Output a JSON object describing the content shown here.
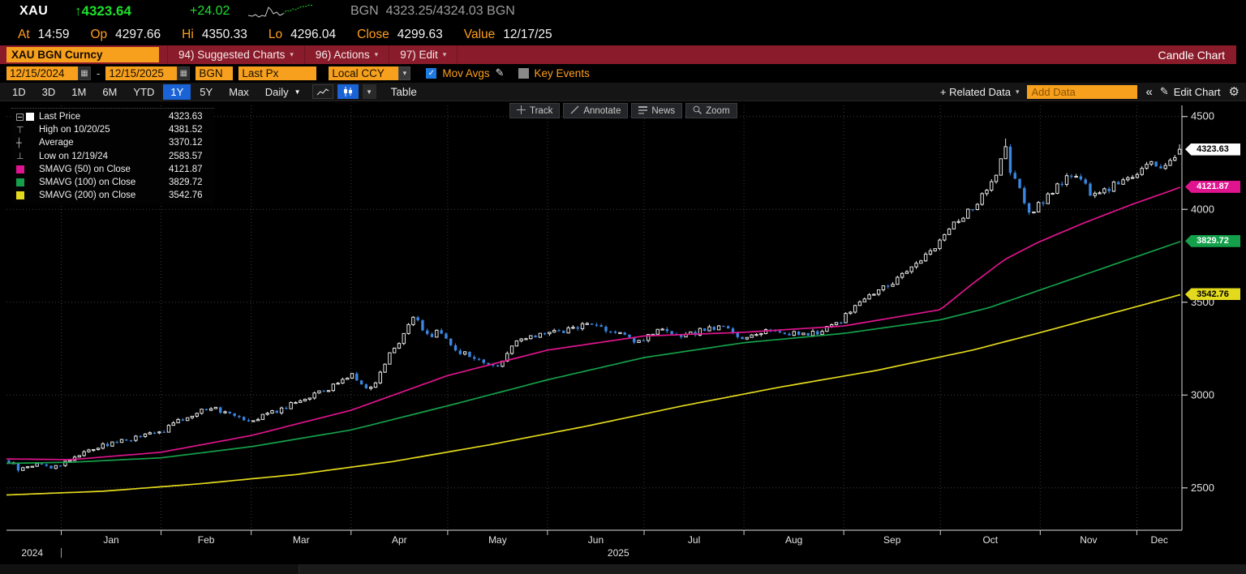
{
  "header": {
    "ticker": "XAU",
    "arrow": "↑",
    "last": "4323.64",
    "change": "+24.02",
    "quote_src_left": "BGN",
    "bid_ask": "4323.25/4324.03",
    "quote_src_right": "BGN",
    "stats": [
      {
        "label": "At",
        "value": "14:59"
      },
      {
        "label": "Op",
        "value": "4297.66"
      },
      {
        "label": "Hi",
        "value": "4350.33"
      },
      {
        "label": "Lo",
        "value": "4296.04"
      },
      {
        "label": "Close",
        "value": "4299.63"
      },
      {
        "label": "Value",
        "value": "12/17/25"
      }
    ],
    "sparkline": {
      "white": [
        [
          0,
          15
        ],
        [
          5,
          16
        ],
        [
          9,
          14
        ],
        [
          13,
          17
        ],
        [
          17,
          15
        ],
        [
          21,
          16
        ],
        [
          25,
          5
        ],
        [
          28,
          8
        ],
        [
          31,
          13
        ],
        [
          35,
          11
        ],
        [
          39,
          15
        ],
        [
          43,
          13
        ]
      ],
      "green": [
        [
          43,
          13
        ],
        [
          47,
          9
        ],
        [
          51,
          10
        ],
        [
          55,
          7
        ],
        [
          59,
          8
        ],
        [
          63,
          5
        ],
        [
          67,
          4
        ],
        [
          71,
          4
        ],
        [
          75,
          2
        ],
        [
          80,
          3
        ]
      ]
    }
  },
  "menubar": {
    "security": "XAU BGN Curncy",
    "items": [
      "94) Suggested Charts",
      "96) Actions",
      "97) Edit"
    ],
    "right_label": "Candle Chart"
  },
  "settings": {
    "date_from": "12/15/2024",
    "range_sep": "-",
    "date_to": "12/15/2025",
    "source": "BGN",
    "field": "Last Px",
    "currency": "Local CCY",
    "mov_avgs_label": "Mov Avgs",
    "key_events_label": "Key Events"
  },
  "toolbar": {
    "ranges": [
      "1D",
      "3D",
      "1M",
      "6M",
      "YTD",
      "1Y",
      "5Y",
      "Max"
    ],
    "active_range": "1Y",
    "period": "Daily",
    "table_label": "Table",
    "related_label": "+ Related Data",
    "add_data_placeholder": "Add Data",
    "edit_chart_label": "Edit Chart"
  },
  "chart_tools": {
    "track": "Track",
    "annotate": "Annotate",
    "news": "News",
    "zoom": "Zoom"
  },
  "legend": [
    {
      "icon": "collapse",
      "swatch": "#ffffff",
      "label": "Last Price",
      "value": "4323.63"
    },
    {
      "icon": "high",
      "label": "High on 10/20/25",
      "value": "4381.52"
    },
    {
      "icon": "avg",
      "label": "Average",
      "value": "3370.12"
    },
    {
      "icon": "low",
      "label": "Low on 12/19/24",
      "value": "2583.57"
    },
    {
      "swatch": "#e0148e",
      "label": "SMAVG (50)  on Close",
      "value": "4121.87"
    },
    {
      "swatch": "#14a04a",
      "label": "SMAVG (100)  on Close",
      "value": "3829.72"
    },
    {
      "swatch": "#e3da1d",
      "label": "SMAVG (200)  on Close",
      "value": "3542.76"
    }
  ],
  "colors": {
    "up_candle": "#e8e8e8",
    "down_candle": "#3b86e0",
    "sma50": "#e0148e",
    "sma100": "#14a04a",
    "sma200": "#e3da1d",
    "amber": "#ff9f1e",
    "ticker_green": "#1ce02b",
    "bar_red": "#8a1b2a",
    "field_orange": "#f7a01e",
    "active_blue": "#1a63d6"
  },
  "chart_data": {
    "type": "candlestick",
    "security": "XAU BGN Curncy",
    "range": "1Y",
    "period": "Daily",
    "date_range": [
      "12/15/2024",
      "12/15/2025"
    ],
    "days_total": 365,
    "candles_count": 250,
    "ylim": [
      2272,
      4560
    ],
    "y_ticks": [
      2500,
      3000,
      3500,
      4000,
      4500
    ],
    "y_minor_step": 250,
    "month_boundaries_day": [
      17,
      48,
      76,
      107,
      137,
      168,
      198,
      229,
      260,
      290,
      321,
      351
    ],
    "month_labels": [
      "Jan",
      "Feb",
      "Mar",
      "Apr",
      "May",
      "Jun",
      "Jul",
      "Aug",
      "Sep",
      "Oct",
      "Nov",
      "Dec"
    ],
    "year_labels": [
      {
        "label": "2024",
        "day": 8
      },
      {
        "label": "2025",
        "day": 190
      }
    ],
    "last_price": 4323.63,
    "average": 3370.12,
    "high_marker": {
      "date": "10/20/25",
      "value": 4381.52,
      "day": 310
    },
    "low_marker": {
      "date": "12/19/24",
      "value": 2583.57,
      "day": 4
    },
    "last_candle": {
      "open": 4297.66,
      "high": 4350.33,
      "low": 4296.04,
      "close": 4323.63
    },
    "close_path": [
      [
        0,
        2648
      ],
      [
        3,
        2615
      ],
      [
        4,
        2592
      ],
      [
        7,
        2618
      ],
      [
        10,
        2632
      ],
      [
        14,
        2610
      ],
      [
        17,
        2628
      ],
      [
        21,
        2665
      ],
      [
        25,
        2705
      ],
      [
        29,
        2720
      ],
      [
        33,
        2745
      ],
      [
        38,
        2762
      ],
      [
        42,
        2780
      ],
      [
        48,
        2802
      ],
      [
        52,
        2845
      ],
      [
        56,
        2880
      ],
      [
        60,
        2915
      ],
      [
        63,
        2935
      ],
      [
        66,
        2918
      ],
      [
        70,
        2905
      ],
      [
        73,
        2882
      ],
      [
        76,
        2862
      ],
      [
        80,
        2898
      ],
      [
        84,
        2915
      ],
      [
        88,
        2945
      ],
      [
        92,
        2982
      ],
      [
        96,
        3005
      ],
      [
        100,
        3028
      ],
      [
        104,
        3082
      ],
      [
        107,
        3118
      ],
      [
        110,
        3062
      ],
      [
        113,
        3032
      ],
      [
        116,
        3120
      ],
      [
        119,
        3225
      ],
      [
        122,
        3292
      ],
      [
        125,
        3385
      ],
      [
        127,
        3428
      ],
      [
        129,
        3342
      ],
      [
        131,
        3310
      ],
      [
        134,
        3352
      ],
      [
        137,
        3288
      ],
      [
        140,
        3242
      ],
      [
        144,
        3205
      ],
      [
        148,
        3182
      ],
      [
        152,
        3148
      ],
      [
        155,
        3218
      ],
      [
        158,
        3285
      ],
      [
        162,
        3302
      ],
      [
        165,
        3322
      ],
      [
        168,
        3348
      ],
      [
        172,
        3335
      ],
      [
        176,
        3362
      ],
      [
        180,
        3382
      ],
      [
        184,
        3372
      ],
      [
        188,
        3345
      ],
      [
        192,
        3312
      ],
      [
        196,
        3285
      ],
      [
        200,
        3332
      ],
      [
        204,
        3345
      ],
      [
        208,
        3310
      ],
      [
        212,
        3322
      ],
      [
        216,
        3352
      ],
      [
        220,
        3365
      ],
      [
        224,
        3358
      ],
      [
        228,
        3302
      ],
      [
        232,
        3328
      ],
      [
        236,
        3352
      ],
      [
        240,
        3338
      ],
      [
        244,
        3332
      ],
      [
        248,
        3322
      ],
      [
        252,
        3338
      ],
      [
        256,
        3372
      ],
      [
        260,
        3412
      ],
      [
        263,
        3478
      ],
      [
        267,
        3525
      ],
      [
        271,
        3562
      ],
      [
        275,
        3608
      ],
      [
        279,
        3655
      ],
      [
        283,
        3722
      ],
      [
        287,
        3772
      ],
      [
        291,
        3865
      ],
      [
        294,
        3928
      ],
      [
        297,
        3962
      ],
      [
        300,
        4005
      ],
      [
        303,
        4068
      ],
      [
        306,
        4135
      ],
      [
        308,
        4205
      ],
      [
        310,
        4340
      ],
      [
        312,
        4185
      ],
      [
        314,
        4122
      ],
      [
        316,
        4042
      ],
      [
        318,
        3988
      ],
      [
        320,
        4012
      ],
      [
        323,
        4062
      ],
      [
        326,
        4125
      ],
      [
        329,
        4165
      ],
      [
        332,
        4188
      ],
      [
        335,
        4152
      ],
      [
        337,
        4062
      ],
      [
        339,
        4082
      ],
      [
        341,
        4095
      ],
      [
        344,
        4135
      ],
      [
        347,
        4155
      ],
      [
        350,
        4195
      ],
      [
        353,
        4222
      ],
      [
        356,
        4245
      ],
      [
        359,
        4212
      ],
      [
        361,
        4252
      ],
      [
        363,
        4295
      ],
      [
        365,
        4323.63
      ]
    ],
    "smavg": [
      {
        "name": "SMAVG (50) on Close",
        "color": "#e0148e",
        "last": 4121.87,
        "points": [
          [
            0,
            2656
          ],
          [
            20,
            2652
          ],
          [
            48,
            2692
          ],
          [
            76,
            2782
          ],
          [
            107,
            2918
          ],
          [
            137,
            3105
          ],
          [
            168,
            3242
          ],
          [
            198,
            3318
          ],
          [
            229,
            3338
          ],
          [
            260,
            3372
          ],
          [
            290,
            3460
          ],
          [
            300,
            3600
          ],
          [
            310,
            3730
          ],
          [
            320,
            3820
          ],
          [
            335,
            3930
          ],
          [
            350,
            4030
          ],
          [
            365,
            4121.87
          ]
        ]
      },
      {
        "name": "SMAVG (100) on Close",
        "color": "#14a04a",
        "last": 3829.72,
        "points": [
          [
            0,
            2632
          ],
          [
            20,
            2638
          ],
          [
            48,
            2662
          ],
          [
            76,
            2722
          ],
          [
            107,
            2812
          ],
          [
            137,
            2942
          ],
          [
            168,
            3082
          ],
          [
            198,
            3202
          ],
          [
            229,
            3282
          ],
          [
            260,
            3332
          ],
          [
            290,
            3405
          ],
          [
            305,
            3470
          ],
          [
            320,
            3560
          ],
          [
            335,
            3650
          ],
          [
            350,
            3740
          ],
          [
            365,
            3829.72
          ]
        ]
      },
      {
        "name": "SMAVG (200) on Close",
        "color": "#e3da1d",
        "last": 3542.76,
        "points": [
          [
            0,
            2462
          ],
          [
            30,
            2482
          ],
          [
            60,
            2522
          ],
          [
            90,
            2572
          ],
          [
            120,
            2642
          ],
          [
            150,
            2732
          ],
          [
            180,
            2832
          ],
          [
            210,
            2942
          ],
          [
            240,
            3042
          ],
          [
            270,
            3132
          ],
          [
            300,
            3242
          ],
          [
            320,
            3332
          ],
          [
            335,
            3402
          ],
          [
            350,
            3472
          ],
          [
            365,
            3542.76
          ]
        ]
      }
    ]
  }
}
